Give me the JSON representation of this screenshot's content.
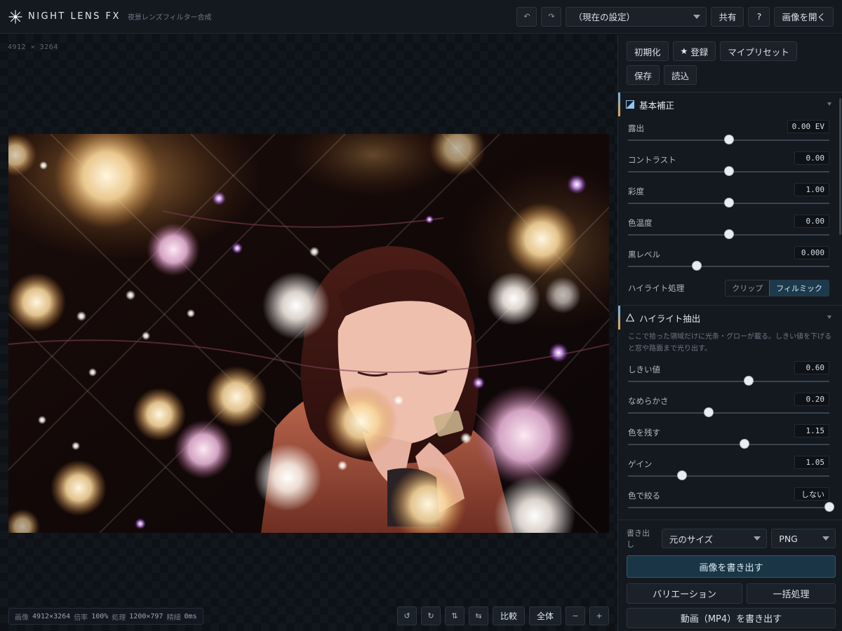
{
  "header": {
    "title": "NIGHT LENS FX",
    "subtitle": "夜景レンズフィルター合成",
    "undo_icon": "undo-icon",
    "redo_icon": "redo-icon",
    "preset_select": "（現在の設定）",
    "share_label": "共有",
    "help_label": "?",
    "open_label": "画像を開く"
  },
  "canvas": {
    "dimensions": "4912 × 3264",
    "status": {
      "image_label": "画像",
      "image_value": "4912×3264",
      "zoom_label": "倍率",
      "zoom_value": "100%",
      "proc_label": "処理",
      "proc_value": "1200×797",
      "detail_label": "精細",
      "detail_value": "0ms"
    },
    "tools": {
      "rotate_left": "↺",
      "rotate_right": "↻",
      "flip_v": "⇅",
      "flip_h": "⇆",
      "compare": "比較",
      "fit": "全体",
      "zoom_out": "−",
      "zoom_in": "+"
    }
  },
  "panel": {
    "presets": {
      "reset": "初期化",
      "register": "登録",
      "my_presets": "マイプリセット",
      "save": "保存",
      "load": "読込"
    },
    "basic": {
      "title": "基本補正",
      "sliders": [
        {
          "label": "露出",
          "value": "0.00 EV",
          "position": 0.5
        },
        {
          "label": "コントラスト",
          "value": "0.00",
          "position": 0.5
        },
        {
          "label": "彩度",
          "value": "1.00",
          "position": 0.5
        },
        {
          "label": "色温度",
          "value": "0.00",
          "position": 0.5
        },
        {
          "label": "黒レベル",
          "value": "0.000",
          "position": 0.34
        }
      ],
      "highlight": {
        "label": "ハイライト処理",
        "options": [
          "クリップ",
          "フィルミック"
        ],
        "selected": "フィルミック"
      }
    },
    "extract": {
      "title": "ハイライト抽出",
      "note": "ここで拾った領域だけに光条・グローが載る。しきい値を下げると窓や路面まで光り出す。",
      "sliders": [
        {
          "label": "しきい値",
          "value": "0.60",
          "position": 0.6
        },
        {
          "label": "なめらかさ",
          "value": "0.20",
          "position": 0.4
        },
        {
          "label": "色を残す",
          "value": "1.15",
          "position": 0.58
        },
        {
          "label": "ゲイン",
          "value": "1.05",
          "position": 0.27
        },
        {
          "label": "色で絞る",
          "value": "しない",
          "position": 1.0
        }
      ]
    },
    "export": {
      "label": "書き出し",
      "size": "元のサイズ",
      "format": "PNG",
      "export_image": "画像を書き出す",
      "variation": "バリエーション",
      "batch": "一括処理",
      "video": "動画（MP4）を書き出す"
    }
  },
  "colors": {
    "accent": "#2c5a74",
    "background": "#0f1319",
    "panel": "#141920"
  }
}
